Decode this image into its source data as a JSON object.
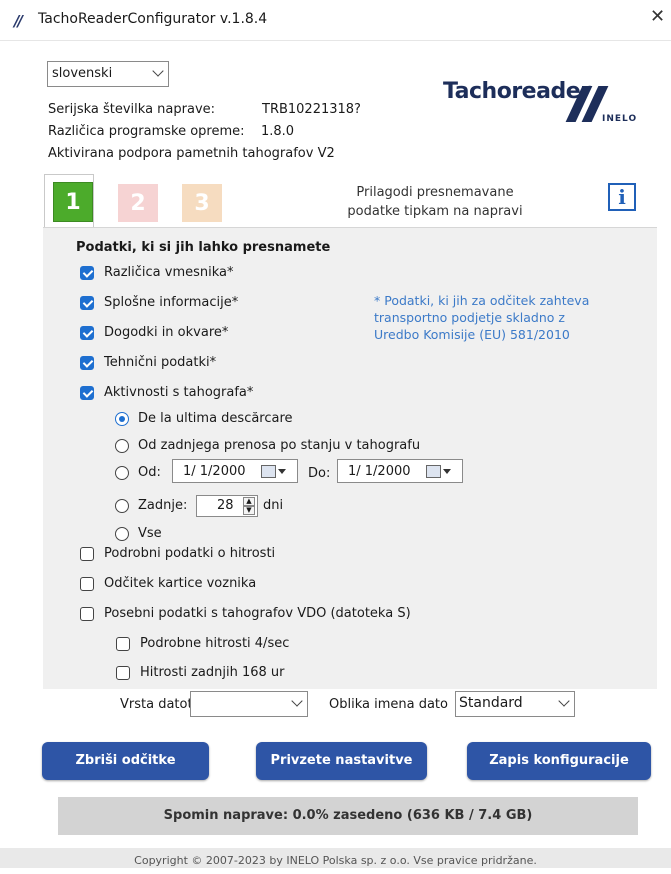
{
  "window": {
    "title": "TachoReaderConfigurator v.1.8.4",
    "close_glyph": "✕"
  },
  "language_select": {
    "value": "slovenski"
  },
  "device_info": {
    "serial_label": "Serijska številka naprave:",
    "serial_value": "TRB10221318?",
    "software_label": "Različica programske opreme:",
    "software_value": "1.8.0",
    "activated": "Aktivirana podpora pametnih tahografov V2"
  },
  "logo": {
    "text": "Tachoreader",
    "sub": "INELO"
  },
  "tabs": [
    {
      "label": "1",
      "color": "#4cab2b"
    },
    {
      "label": "2",
      "color": "#f6d3d3"
    },
    {
      "label": "3",
      "color": "#f6dcc0"
    }
  ],
  "tab_caption": {
    "line1": "Prilagodi presnemavane",
    "line2": "podatke tipkam na napravi"
  },
  "info_button": {
    "glyph": "i"
  },
  "section_title": "Podatki, ki si jih lahko presnamete",
  "checks": [
    {
      "label": "Različica vmesnika*",
      "checked": true
    },
    {
      "label": "Splošne informacije*",
      "checked": true
    },
    {
      "label": "Dogodki in okvare*",
      "checked": true
    },
    {
      "label": "Tehnični podatki*",
      "checked": true
    },
    {
      "label": "Aktivnosti s tahografa*",
      "checked": true
    }
  ],
  "note": {
    "line1": "* Podatki, ki jih za odčitek zahteva",
    "line2": "transportno podjetje skladno z",
    "line3": "Uredbo Komisije (EU) 581/2010"
  },
  "radios": {
    "opt1": "De la ultima descărcare",
    "opt2": "Od zadnjega prenosa po stanju v tahografu",
    "opt3_from": "Od:",
    "from_date": "1/ 1/2000",
    "to_label": "Do:",
    "to_date": "1/ 1/2000",
    "opt4": "Zadnje:",
    "days_value": "28",
    "days_label": "dni",
    "opt5": "Vse",
    "selected": "opt1"
  },
  "extra_checks": [
    {
      "label": "Podrobni podatki o hitrosti",
      "checked": false
    },
    {
      "label": "Odčitek kartice voznika",
      "checked": false
    },
    {
      "label": "Posebni podatki s tahografov VDO (datoteka S)",
      "checked": false
    },
    {
      "label": "Podrobne hitrosti 4/sec",
      "checked": false
    },
    {
      "label": "Hitrosti zadnjih 168 ur",
      "checked": false
    }
  ],
  "file_type": {
    "label": "Vrsta datoteke",
    "value": ""
  },
  "file_name": {
    "label": "Oblika imena dato",
    "value": "Standard"
  },
  "buttons": {
    "delete": "Zbriši odčitke",
    "defaults": "Privzete nastavitve",
    "write": "Zapis konfiguracije"
  },
  "memory": "Spomin naprave: 0.0% zasedeno (636 KB / 7.4 GB)",
  "footer": "Copyright © 2007-2023 by INELO Polska sp. z o.o. Vse pravice pridržane.",
  "colors": {
    "accent_blue": "#2e55a6",
    "checkbox_blue": "#1e6fd0",
    "note_blue": "#3c7ac8",
    "brand_navy": "#1d2e5a"
  }
}
